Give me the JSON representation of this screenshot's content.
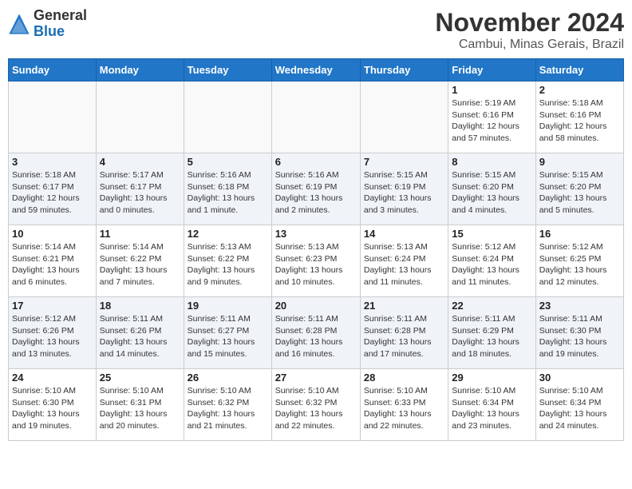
{
  "header": {
    "logo_general": "General",
    "logo_blue": "Blue",
    "month_title": "November 2024",
    "location": "Cambui, Minas Gerais, Brazil"
  },
  "weekdays": [
    "Sunday",
    "Monday",
    "Tuesday",
    "Wednesday",
    "Thursday",
    "Friday",
    "Saturday"
  ],
  "weeks": [
    [
      {
        "day": "",
        "info": ""
      },
      {
        "day": "",
        "info": ""
      },
      {
        "day": "",
        "info": ""
      },
      {
        "day": "",
        "info": ""
      },
      {
        "day": "",
        "info": ""
      },
      {
        "day": "1",
        "info": "Sunrise: 5:19 AM\nSunset: 6:16 PM\nDaylight: 12 hours and 57 minutes."
      },
      {
        "day": "2",
        "info": "Sunrise: 5:18 AM\nSunset: 6:16 PM\nDaylight: 12 hours and 58 minutes."
      }
    ],
    [
      {
        "day": "3",
        "info": "Sunrise: 5:18 AM\nSunset: 6:17 PM\nDaylight: 12 hours and 59 minutes."
      },
      {
        "day": "4",
        "info": "Sunrise: 5:17 AM\nSunset: 6:17 PM\nDaylight: 13 hours and 0 minutes."
      },
      {
        "day": "5",
        "info": "Sunrise: 5:16 AM\nSunset: 6:18 PM\nDaylight: 13 hours and 1 minute."
      },
      {
        "day": "6",
        "info": "Sunrise: 5:16 AM\nSunset: 6:19 PM\nDaylight: 13 hours and 2 minutes."
      },
      {
        "day": "7",
        "info": "Sunrise: 5:15 AM\nSunset: 6:19 PM\nDaylight: 13 hours and 3 minutes."
      },
      {
        "day": "8",
        "info": "Sunrise: 5:15 AM\nSunset: 6:20 PM\nDaylight: 13 hours and 4 minutes."
      },
      {
        "day": "9",
        "info": "Sunrise: 5:15 AM\nSunset: 6:20 PM\nDaylight: 13 hours and 5 minutes."
      }
    ],
    [
      {
        "day": "10",
        "info": "Sunrise: 5:14 AM\nSunset: 6:21 PM\nDaylight: 13 hours and 6 minutes."
      },
      {
        "day": "11",
        "info": "Sunrise: 5:14 AM\nSunset: 6:22 PM\nDaylight: 13 hours and 7 minutes."
      },
      {
        "day": "12",
        "info": "Sunrise: 5:13 AM\nSunset: 6:22 PM\nDaylight: 13 hours and 9 minutes."
      },
      {
        "day": "13",
        "info": "Sunrise: 5:13 AM\nSunset: 6:23 PM\nDaylight: 13 hours and 10 minutes."
      },
      {
        "day": "14",
        "info": "Sunrise: 5:13 AM\nSunset: 6:24 PM\nDaylight: 13 hours and 11 minutes."
      },
      {
        "day": "15",
        "info": "Sunrise: 5:12 AM\nSunset: 6:24 PM\nDaylight: 13 hours and 11 minutes."
      },
      {
        "day": "16",
        "info": "Sunrise: 5:12 AM\nSunset: 6:25 PM\nDaylight: 13 hours and 12 minutes."
      }
    ],
    [
      {
        "day": "17",
        "info": "Sunrise: 5:12 AM\nSunset: 6:26 PM\nDaylight: 13 hours and 13 minutes."
      },
      {
        "day": "18",
        "info": "Sunrise: 5:11 AM\nSunset: 6:26 PM\nDaylight: 13 hours and 14 minutes."
      },
      {
        "day": "19",
        "info": "Sunrise: 5:11 AM\nSunset: 6:27 PM\nDaylight: 13 hours and 15 minutes."
      },
      {
        "day": "20",
        "info": "Sunrise: 5:11 AM\nSunset: 6:28 PM\nDaylight: 13 hours and 16 minutes."
      },
      {
        "day": "21",
        "info": "Sunrise: 5:11 AM\nSunset: 6:28 PM\nDaylight: 13 hours and 17 minutes."
      },
      {
        "day": "22",
        "info": "Sunrise: 5:11 AM\nSunset: 6:29 PM\nDaylight: 13 hours and 18 minutes."
      },
      {
        "day": "23",
        "info": "Sunrise: 5:11 AM\nSunset: 6:30 PM\nDaylight: 13 hours and 19 minutes."
      }
    ],
    [
      {
        "day": "24",
        "info": "Sunrise: 5:10 AM\nSunset: 6:30 PM\nDaylight: 13 hours and 19 minutes."
      },
      {
        "day": "25",
        "info": "Sunrise: 5:10 AM\nSunset: 6:31 PM\nDaylight: 13 hours and 20 minutes."
      },
      {
        "day": "26",
        "info": "Sunrise: 5:10 AM\nSunset: 6:32 PM\nDaylight: 13 hours and 21 minutes."
      },
      {
        "day": "27",
        "info": "Sunrise: 5:10 AM\nSunset: 6:32 PM\nDaylight: 13 hours and 22 minutes."
      },
      {
        "day": "28",
        "info": "Sunrise: 5:10 AM\nSunset: 6:33 PM\nDaylight: 13 hours and 22 minutes."
      },
      {
        "day": "29",
        "info": "Sunrise: 5:10 AM\nSunset: 6:34 PM\nDaylight: 13 hours and 23 minutes."
      },
      {
        "day": "30",
        "info": "Sunrise: 5:10 AM\nSunset: 6:34 PM\nDaylight: 13 hours and 24 minutes."
      }
    ]
  ]
}
